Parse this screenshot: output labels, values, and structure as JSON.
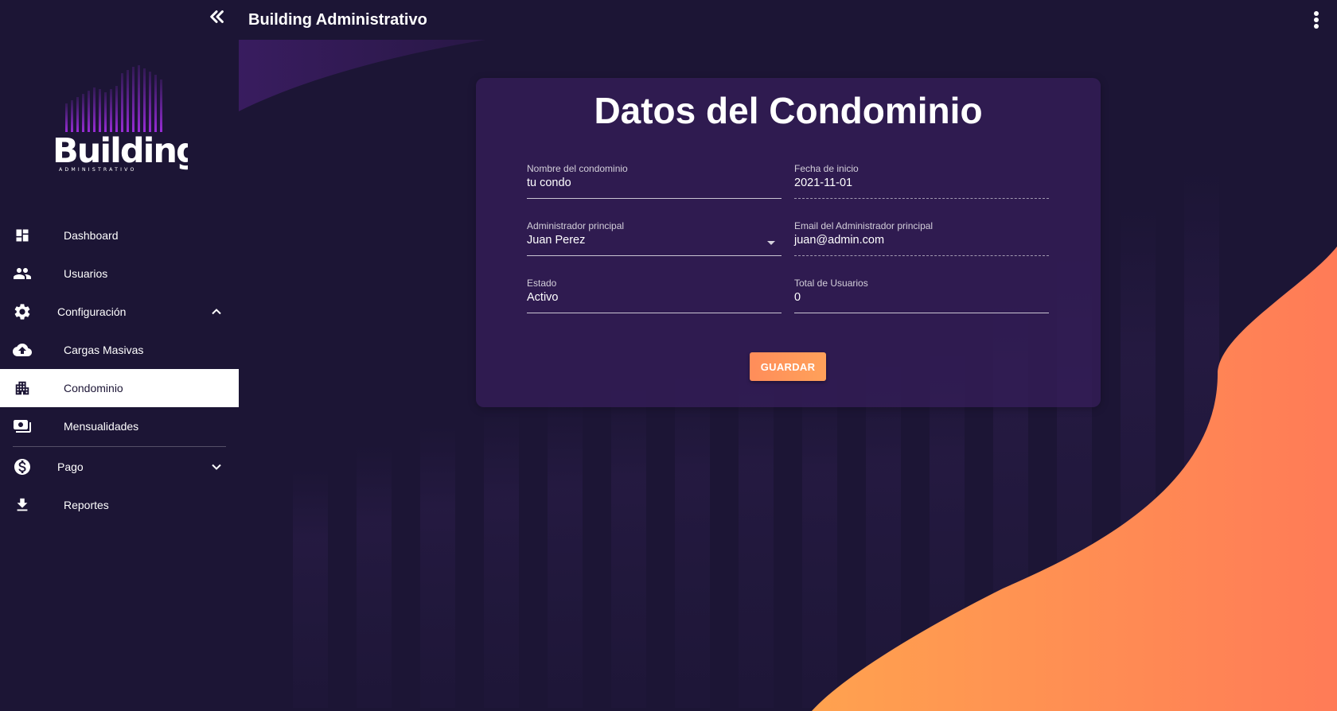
{
  "app": {
    "title": "Building Administrativo"
  },
  "logo": {
    "word": "Building",
    "subtitle": "ADMINISTRATIVO"
  },
  "sidebar": {
    "items": [
      {
        "label": "Dashboard",
        "icon": "dashboard-icon"
      },
      {
        "label": "Usuarios",
        "icon": "people-icon"
      },
      {
        "label": "Configuración",
        "icon": "gear-icon",
        "expanded": true
      },
      {
        "label": "Cargas Masivas",
        "icon": "cloud-upload-icon"
      },
      {
        "label": "Condominio",
        "icon": "apartment-icon",
        "active": true
      },
      {
        "label": "Mensualidades",
        "icon": "payments-icon"
      },
      {
        "label": "Pago",
        "icon": "dollar-circle-icon",
        "expanded": false
      },
      {
        "label": "Reportes",
        "icon": "download-icon"
      }
    ]
  },
  "form": {
    "title": "Datos del Condominio",
    "fields": {
      "nombre": {
        "label": "Nombre del condominio",
        "value": "tu condo"
      },
      "fecha": {
        "label": "Fecha de inicio",
        "value": "2021-11-01"
      },
      "admin": {
        "label": "Administrador principal",
        "value": "Juan Perez"
      },
      "email": {
        "label": "Email del Administrador principal",
        "value": "juan@admin.com"
      },
      "estado": {
        "label": "Estado",
        "value": "Activo"
      },
      "total": {
        "label": "Total de Usuarios",
        "value": "0"
      }
    },
    "save_label": "GUARDAR"
  },
  "colors": {
    "background": "#1c1535",
    "card": "#341e58",
    "accent": "#ff8d5a",
    "active_item": "#ffffff"
  }
}
